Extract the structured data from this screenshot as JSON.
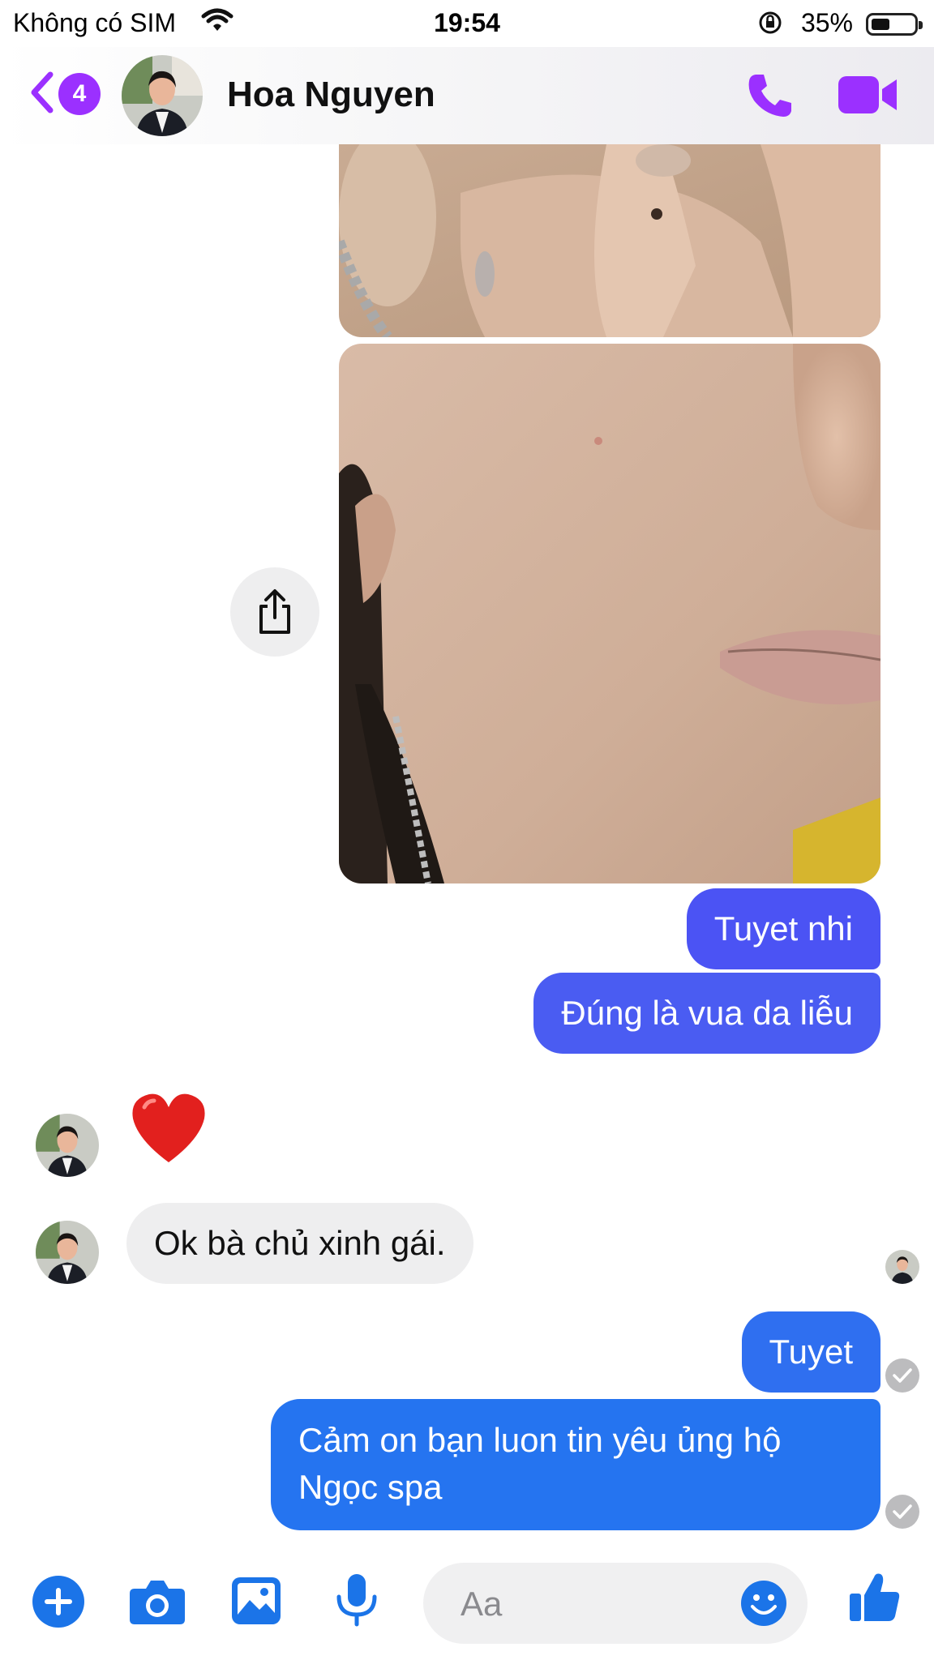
{
  "status_bar": {
    "carrier": "Không có SIM",
    "time": "19:54",
    "battery": "35%"
  },
  "header": {
    "back_badge": "4",
    "contact_name": "Hoa Nguyen",
    "accent_color": "#9b30ff"
  },
  "messages": {
    "out1": "Tuyet nhi",
    "out2": "Đúng là vua da liễu",
    "reaction": "❤️",
    "in1": "Ok  bà chủ xinh gái.",
    "out3": "Tuyet",
    "out4_line1": "Cảm on bạn luon tin yêu ủng hộ",
    "out4_line2": "Ngọc spa"
  },
  "composer": {
    "placeholder": "Aa",
    "icons": [
      "plus-icon",
      "camera-icon",
      "image-icon",
      "microphone-icon",
      "emoji-icon",
      "like-icon"
    ],
    "accent_color": "#1b74e8"
  }
}
